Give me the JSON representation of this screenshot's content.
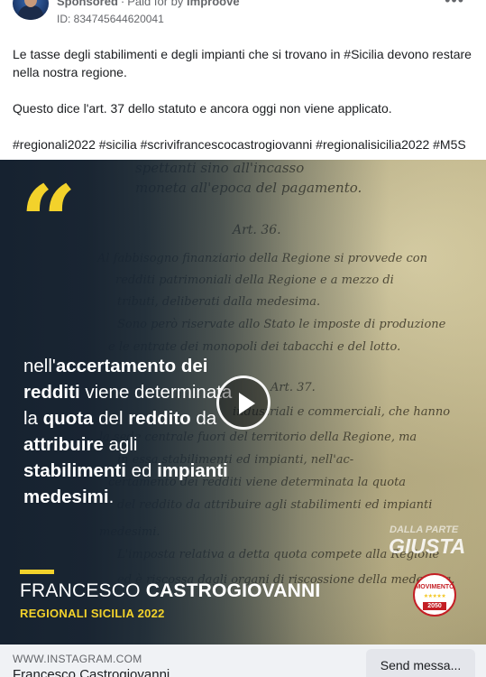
{
  "header": {
    "sponsored_label": "Sponsored",
    "paid_by_label": "Paid for by",
    "payer": "Improove",
    "ad_id": "ID: 834745644620041",
    "more_icon": "more-options-icon"
  },
  "post": {
    "paragraph1": "Le tasse degli stabilimenti e degli impianti che si trovano in #Sicilia devono restare nella nostra regione.",
    "paragraph2": "Questo dice l'art. 37 dello statuto e ancora oggi non viene applicato.",
    "hashtags": "#regionali2022 #sicilia #scrivifrancescocastrogiovanni #regionalisicilia2022 #M5S"
  },
  "media": {
    "quote_mark": "“",
    "quote_lines": [
      [
        {
          "t": "nell'",
          "b": false
        },
        {
          "t": "accertamento dei",
          "b": true
        }
      ],
      [
        {
          "t": "redditi",
          "b": true
        },
        {
          "t": " viene determinata",
          "b": false
        }
      ],
      [
        {
          "t": "la ",
          "b": false
        },
        {
          "t": "quota",
          "b": true
        },
        {
          "t": " del ",
          "b": false
        },
        {
          "t": "reddito",
          "b": true
        },
        {
          "t": " da",
          "b": false
        }
      ],
      [
        {
          "t": "attribuire",
          "b": true
        },
        {
          "t": " agli",
          "b": false
        }
      ],
      [
        {
          "t": "stabilimenti",
          "b": true
        },
        {
          "t": " ed ",
          "b": false
        },
        {
          "t": "impianti",
          "b": true
        }
      ],
      [
        {
          "t": "medesimi",
          "b": true
        },
        {
          "t": ".",
          "b": false
        }
      ]
    ],
    "handwriting": [
      "spettanti sino all'incasso",
      "moneta all'epoca del pagamento.",
      "Art. 36.",
      "Al fabbisogno finanziario della Regione si provvede con",
      "redditi patrimoniali della Regione e a mezzo di",
      "tributi, deliberati dalla medesima.",
      "Sono però riservate allo Stato le imposte di produzione",
      "e le entrate dei monopoli dei tabacchi e del lotto.",
      "Art. 37.",
      "industriali e commerciali, che hanno",
      "la sede centrale fuori del territorio della Regione, ma",
      "in essa stabilimenti ed impianti, nell'ac-",
      "certamento dei redditi viene determinata la quota",
      "del reddito da attribuire agli stabilimenti ed impianti",
      "medesimi.",
      "L'imposta relativa a detta quota compete alla Regione",
      "ed è riscossa dagli organi di riscossione della medesima."
    ],
    "candidate_first": "FRANCESCO",
    "candidate_last": "CASTROGIOVANNI",
    "region": "REGIONALI SICILIA 2022",
    "slogan_small": "DALLA PARTE",
    "slogan_big": "GIUSTA",
    "party_logo_text": "MOVIMENTO",
    "party_logo_stars": "★★★★★",
    "party_logo_year": "2050",
    "play_icon": "play-icon"
  },
  "footer": {
    "domain": "WWW.INSTAGRAM.COM",
    "title": "Francesco Castrogiovanni",
    "cta_label": "Send messa..."
  },
  "colors": {
    "accent_yellow": "#f3d22b",
    "overlay_navy": "#162230",
    "party_red": "#c41e24",
    "footer_bg": "#f0f2f5",
    "cta_bg": "#e4e6eb"
  }
}
